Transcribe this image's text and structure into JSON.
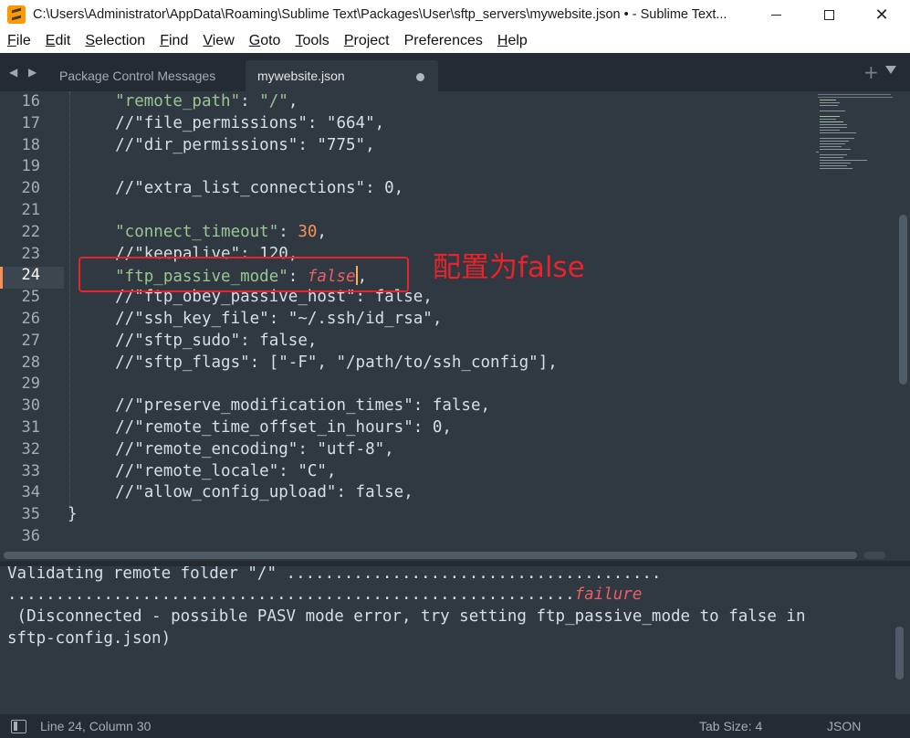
{
  "window": {
    "title": "C:\\Users\\Administrator\\AppData\\Roaming\\Sublime Text\\Packages\\User\\sftp_servers\\mywebsite.json • - Sublime Text...",
    "minimize_label": "",
    "close_glyph": "✕"
  },
  "menu": [
    {
      "u": "F",
      "rest": "ile"
    },
    {
      "u": "E",
      "rest": "dit"
    },
    {
      "u": "S",
      "rest": "election"
    },
    {
      "u": "F",
      "rest": "ind"
    },
    {
      "u": "V",
      "rest": "iew"
    },
    {
      "u": "G",
      "rest": "oto"
    },
    {
      "u": "T",
      "rest": "ools"
    },
    {
      "u": "P",
      "rest": "roject"
    },
    {
      "u": "",
      "rest": "Preferences"
    },
    {
      "u": "H",
      "rest": "elp"
    }
  ],
  "tabs": {
    "nav": "◀ ▶",
    "inactive": "Package Control Messages",
    "active": "mywebsite.json",
    "plus": "+"
  },
  "editor": {
    "current_line": 24,
    "lines": [
      {
        "n": "16",
        "parts": [
          [
            "str-key",
            "    \"remote_path\""
          ],
          [
            "punc",
            ": "
          ],
          [
            "str-key",
            "\"/\""
          ],
          [
            "punc",
            ","
          ]
        ]
      },
      {
        "n": "17",
        "parts": [
          [
            "comment",
            "    //\"file_permissions\": \"664\","
          ]
        ]
      },
      {
        "n": "18",
        "parts": [
          [
            "comment",
            "    //\"dir_permissions\": \"775\","
          ]
        ]
      },
      {
        "n": "19",
        "parts": []
      },
      {
        "n": "20",
        "parts": [
          [
            "comment",
            "    //\"extra_list_connections\": 0,"
          ]
        ]
      },
      {
        "n": "21",
        "parts": []
      },
      {
        "n": "22",
        "parts": [
          [
            "str-key",
            "    \"connect_timeout\""
          ],
          [
            "punc",
            ": "
          ],
          [
            "num",
            "30"
          ],
          [
            "punc",
            ","
          ]
        ]
      },
      {
        "n": "23",
        "parts": [
          [
            "comment",
            "    //\"keepalive\": 120,"
          ]
        ]
      },
      {
        "n": "24",
        "parts": [
          [
            "str-key",
            "    \"ftp_passive_mode\""
          ],
          [
            "punc",
            ": "
          ],
          [
            "kw-false",
            "false"
          ],
          [
            "cursor",
            ""
          ],
          [
            "punc",
            ","
          ]
        ]
      },
      {
        "n": "25",
        "parts": [
          [
            "comment",
            "    //\"ftp_obey_passive_host\": false,"
          ]
        ]
      },
      {
        "n": "26",
        "parts": [
          [
            "comment",
            "    //\"ssh_key_file\": \"~/.ssh/id_rsa\","
          ]
        ]
      },
      {
        "n": "27",
        "parts": [
          [
            "comment",
            "    //\"sftp_sudo\": false,"
          ]
        ]
      },
      {
        "n": "28",
        "parts": [
          [
            "comment",
            "    //\"sftp_flags\": [\"-F\", \"/path/to/ssh_config\"],"
          ]
        ]
      },
      {
        "n": "29",
        "parts": []
      },
      {
        "n": "30",
        "parts": [
          [
            "comment",
            "    //\"preserve_modification_times\": false,"
          ]
        ]
      },
      {
        "n": "31",
        "parts": [
          [
            "comment",
            "    //\"remote_time_offset_in_hours\": 0,"
          ]
        ]
      },
      {
        "n": "32",
        "parts": [
          [
            "comment",
            "    //\"remote_encoding\": \"utf-8\","
          ]
        ]
      },
      {
        "n": "33",
        "parts": [
          [
            "comment",
            "    //\"remote_locale\": \"C\","
          ]
        ]
      },
      {
        "n": "34",
        "parts": [
          [
            "comment",
            "    //\"allow_config_upload\": false,"
          ]
        ]
      },
      {
        "n": "35",
        "parts": [
          [
            "punc",
            "}"
          ]
        ]
      },
      {
        "n": "36",
        "parts": []
      }
    ]
  },
  "annotation": {
    "text": "配置为false",
    "color": "#e8232a"
  },
  "output_panel": {
    "line1": "Validating remote folder \"/\" .......................................",
    "line2_dots": "...........................................................",
    "line2_status": "failure",
    "line3": " (Disconnected - possible PASV mode error, try setting ftp_passive_mode to false in",
    "line4": "sftp-config.json)"
  },
  "status_bar": {
    "position": "Line 24, Column 30",
    "tab_size": "Tab Size: 4",
    "syntax": "JSON"
  },
  "colors": {
    "background": "#303841",
    "string": "#99c794",
    "number": "#f99157",
    "constant": "#ec5f66"
  }
}
